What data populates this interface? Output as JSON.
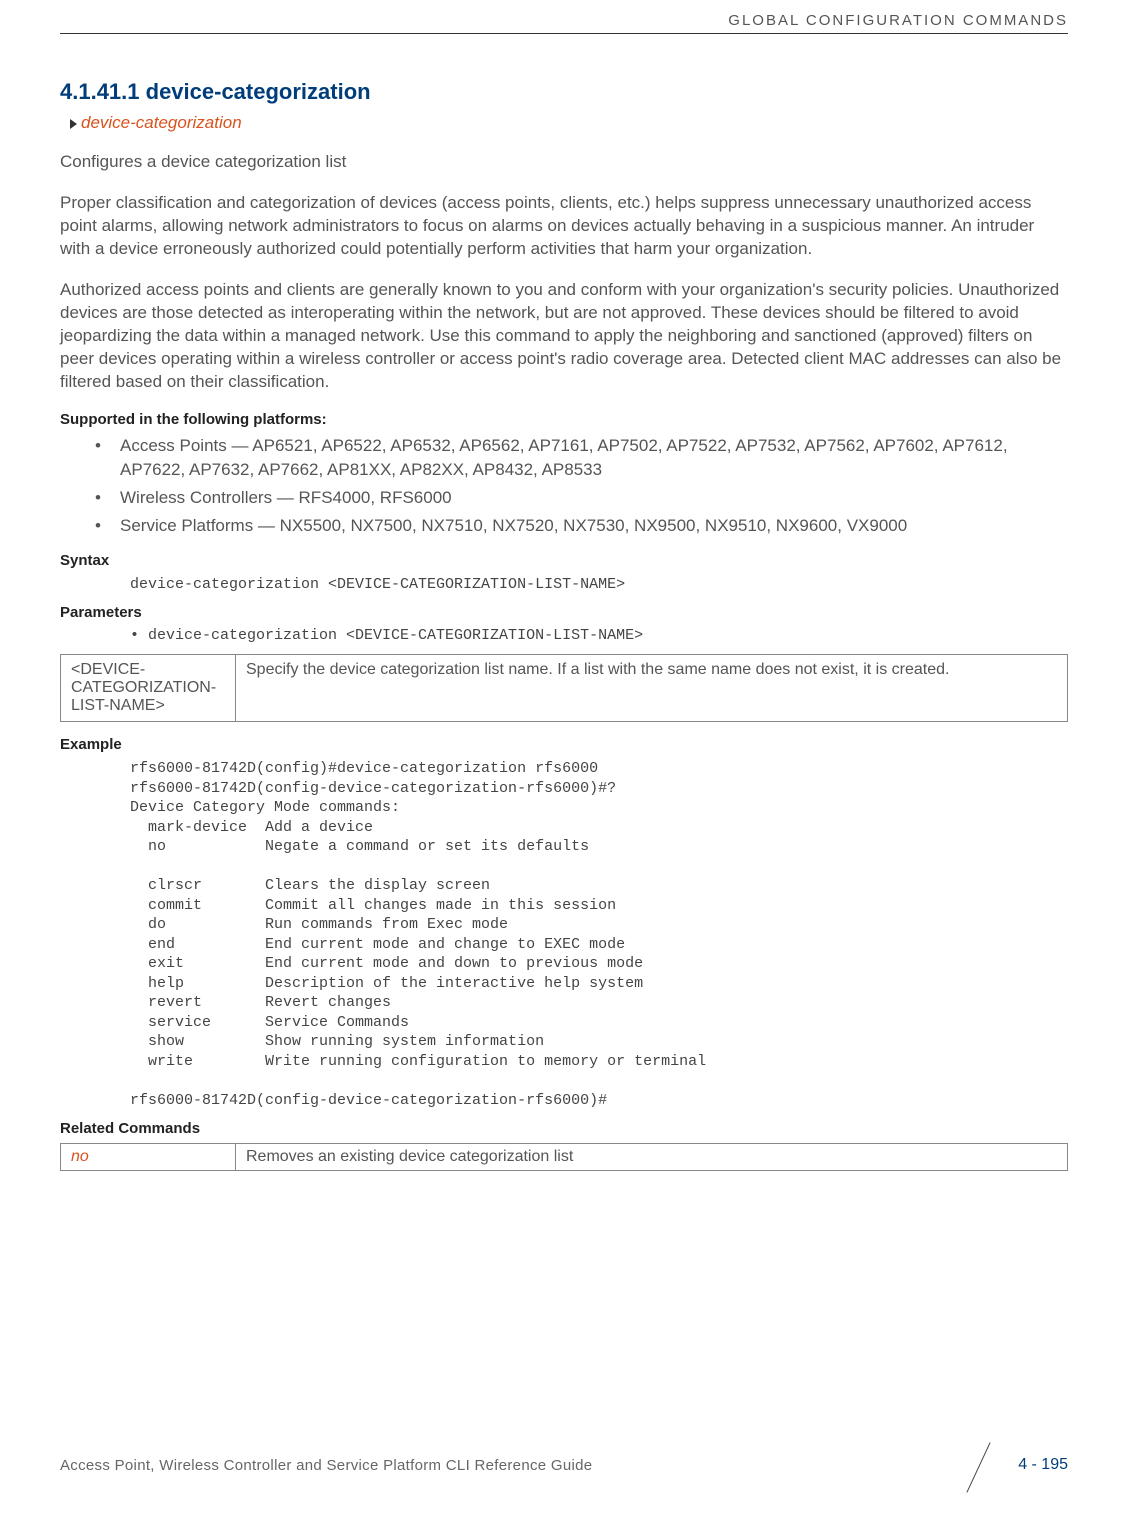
{
  "header": {
    "right": "GLOBAL CONFIGURATION COMMANDS"
  },
  "section": {
    "number_title": "4.1.41.1 device-categorization",
    "breadcrumb": "device-categorization",
    "intro": "Configures a device categorization list",
    "para1": "Proper classification and categorization of devices (access points, clients, etc.) helps suppress unnecessary unauthorized access point alarms, allowing network administrators to focus on alarms on devices actually behaving in a suspicious manner. An intruder with a device erroneously authorized could potentially perform activities that harm your organization.",
    "para2": "Authorized access points and clients are generally known to you and conform with your organization's security policies. Unauthorized devices are those detected as interoperating within the network, but are not approved. These devices should be filtered to avoid jeopardizing the data within a managed network. Use this command to apply the neighboring and sanctioned (approved) filters on peer devices operating within a wireless controller or access point's radio coverage area. Detected client MAC addresses can also be filtered based on their classification."
  },
  "supported": {
    "heading": "Supported in the following platforms:",
    "items": [
      "Access Points — AP6521, AP6522, AP6532, AP6562, AP7161, AP7502, AP7522, AP7532, AP7562, AP7602, AP7612, AP7622, AP7632, AP7662, AP81XX, AP82XX, AP8432, AP8533",
      "Wireless Controllers — RFS4000, RFS6000",
      "Service Platforms — NX5500, NX7500, NX7510, NX7520, NX7530, NX9500, NX9510, NX9600, VX9000"
    ]
  },
  "syntax": {
    "heading": "Syntax",
    "code": "device-categorization <DEVICE-CATEGORIZATION-LIST-NAME>"
  },
  "parameters": {
    "heading": "Parameters",
    "bullet": "• device-categorization <DEVICE-CATEGORIZATION-LIST-NAME>",
    "table": {
      "param": "<DEVICE-CATEGORIZATION-LIST-NAME>",
      "desc": "Specify the device categorization list name. If a list with the same name does not exist, it is created."
    }
  },
  "example": {
    "heading": "Example",
    "code": "rfs6000-81742D(config)#device-categorization rfs6000\nrfs6000-81742D(config-device-categorization-rfs6000)#?\nDevice Category Mode commands:\n  mark-device  Add a device\n  no           Negate a command or set its defaults\n\n  clrscr       Clears the display screen\n  commit       Commit all changes made in this session\n  do           Run commands from Exec mode\n  end          End current mode and change to EXEC mode\n  exit         End current mode and down to previous mode\n  help         Description of the interactive help system\n  revert       Revert changes\n  service      Service Commands\n  show         Show running system information\n  write        Write running configuration to memory or terminal\n\nrfs6000-81742D(config-device-categorization-rfs6000)#"
  },
  "related": {
    "heading": "Related Commands",
    "cmd": "no",
    "desc": "Removes an existing device categorization list"
  },
  "footer": {
    "left": "Access Point, Wireless Controller and Service Platform CLI Reference Guide",
    "page": "4 - 195"
  }
}
